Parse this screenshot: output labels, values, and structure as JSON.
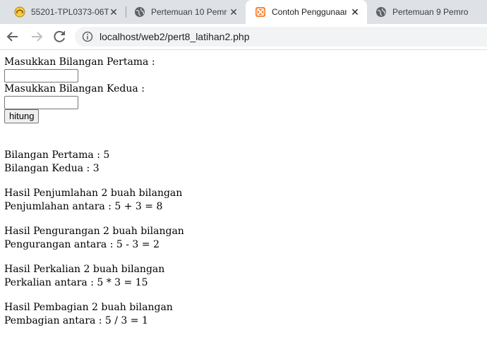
{
  "browser": {
    "tabs": [
      {
        "title": "55201-TPL0373-06T",
        "favicon": "moodle-icon"
      },
      {
        "title": "Pertemuan 10 Pemro",
        "favicon": "globe-icon"
      },
      {
        "title": "Contoh Penggunaan",
        "favicon": "xampp-icon",
        "active": true
      },
      {
        "title": "Pertemuan 9 Pemro",
        "favicon": "globe-icon"
      }
    ],
    "url": "localhost/web2/pert8_latihan2.php"
  },
  "form": {
    "label_first": "Masukkan Bilangan Pertama :",
    "label_second": "Masukkan Bilangan Kedua :",
    "first_value": "",
    "second_value": "",
    "submit_label": "hitung"
  },
  "results": {
    "first": "Bilangan Pertama : 5",
    "second": "Bilangan Kedua : 3",
    "add_title": "Hasil Penjumlahan 2 buah bilangan",
    "add_line": "Penjumlahan antara : 5 + 3 = 8",
    "sub_title": "Hasil Pengurangan 2 buah bilangan",
    "sub_line": "Pengurangan antara : 5 - 3 = 2",
    "mul_title": "Hasil Perkalian 2 buah bilangan",
    "mul_line": "Perkalian antara : 5 * 3 = 15",
    "div_title": "Hasil Pembagian 2 buah bilangan",
    "div_line": "Pembagian antara : 5 / 3 = 1"
  },
  "colors": {
    "tabstrip_bg": "#dee1e6",
    "omnibox_bg": "#f1f3f4",
    "xampp_orange": "#fb7a24"
  }
}
